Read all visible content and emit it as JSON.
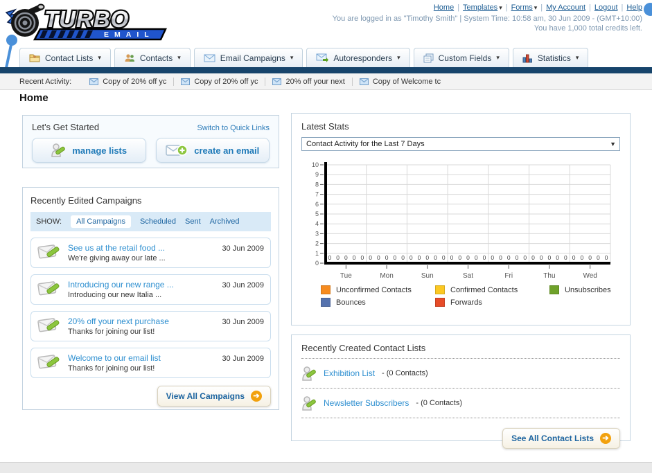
{
  "brand": {
    "top": "TURBO",
    "bottom": "EMAIL"
  },
  "header": {
    "separator": "|",
    "menu_arrow": "▾",
    "links": [
      {
        "label": "Home"
      },
      {
        "label": "Templates",
        "has_menu": true
      },
      {
        "label": "Forms",
        "has_menu": true
      },
      {
        "label": "My Account"
      },
      {
        "label": "Logout"
      },
      {
        "label": "Help"
      }
    ],
    "login_text": "You are logged in as \"Timothy Smith\" | System Time: 10:58 am, 30 Jun 2009 - (GMT+10:00)",
    "credits_text": "You have 1,000 total credits left."
  },
  "nav": {
    "arrow": "▾",
    "tabs": [
      {
        "label": "Contact Lists",
        "icon": "folder-icon"
      },
      {
        "label": "Contacts",
        "icon": "users-icon"
      },
      {
        "label": "Email Campaigns",
        "icon": "envelope-icon"
      },
      {
        "label": "Autoresponders",
        "icon": "autoresponder-icon"
      },
      {
        "label": "Custom Fields",
        "icon": "custom-fields-icon"
      },
      {
        "label": "Statistics",
        "icon": "statistics-icon"
      }
    ]
  },
  "recent_activity": {
    "label": "Recent Activity:",
    "items": [
      "Copy of 20% off yc",
      "Copy of 20% off yc",
      "20% off your next",
      "Copy of Welcome tc"
    ]
  },
  "page": {
    "title": "Home"
  },
  "get_started": {
    "title": "Let's Get Started",
    "switch_link": "Switch to Quick Links",
    "manage_lists": "manage lists",
    "create_email": "create an email"
  },
  "campaigns": {
    "title": "Recently Edited Campaigns",
    "show_label": "SHOW:",
    "filters": [
      "All Campaigns",
      "Scheduled",
      "Sent",
      "Archived"
    ],
    "active_filter": "All Campaigns",
    "items": [
      {
        "title": "See us at the retail food ...",
        "subtitle": "We're giving away our late ...",
        "date": "30 Jun 2009"
      },
      {
        "title": "Introducing our new range ...",
        "subtitle": "Introducing our new Italia ...",
        "date": "30 Jun 2009"
      },
      {
        "title": "20% off your next purchase",
        "subtitle": "Thanks for joining our list!",
        "date": "30 Jun 2009"
      },
      {
        "title": "Welcome to our email list",
        "subtitle": "Thanks for joining our list!",
        "date": "30 Jun 2009"
      }
    ],
    "view_all": "View All Campaigns"
  },
  "stats": {
    "title": "Latest Stats",
    "dropdown_value": "Contact Activity for the Last 7 Days"
  },
  "chart_data": {
    "type": "bar",
    "title": "Contact Activity for the Last 7 Days",
    "categories": [
      "Tue",
      "Mon",
      "Sun",
      "Sat",
      "Fri",
      "Thu",
      "Wed"
    ],
    "series": [
      {
        "name": "Unconfirmed Contacts",
        "color": "#f68b1f",
        "values": [
          0,
          0,
          0,
          0,
          0,
          0,
          0
        ]
      },
      {
        "name": "Confirmed Contacts",
        "color": "#fcc822",
        "values": [
          0,
          0,
          0,
          0,
          0,
          0,
          0
        ]
      },
      {
        "name": "Unsubscribes",
        "color": "#6fa22a",
        "values": [
          0,
          0,
          0,
          0,
          0,
          0,
          0
        ]
      },
      {
        "name": "Bounces",
        "color": "#5572ae",
        "values": [
          0,
          0,
          0,
          0,
          0,
          0,
          0
        ]
      },
      {
        "name": "Forwards",
        "color": "#e74c28",
        "values": [
          0,
          0,
          0,
          0,
          0,
          0,
          0
        ]
      }
    ],
    "xlabel": "",
    "ylabel": "",
    "ylim": [
      0,
      10
    ],
    "yticks": [
      0,
      1,
      2,
      3,
      4,
      5,
      6,
      7,
      8,
      9,
      10
    ],
    "grid": true,
    "legend_position": "bottom"
  },
  "contact_lists": {
    "title": "Recently Created Contact Lists",
    "items": [
      {
        "name": "Exhibition List",
        "detail": "- (0 Contacts)"
      },
      {
        "name": "Newsletter Subscribers",
        "detail": "- (0 Contacts)"
      }
    ],
    "see_all": "See All Contact Lists"
  },
  "icons": {
    "forward_arrow": "➔",
    "dropdown": "▼"
  },
  "colors": {
    "link_blue": "#1c64a0",
    "navy_bar": "#17446b",
    "annotation_blue": "#4a90d9",
    "orange_button": "#f2a10d"
  }
}
